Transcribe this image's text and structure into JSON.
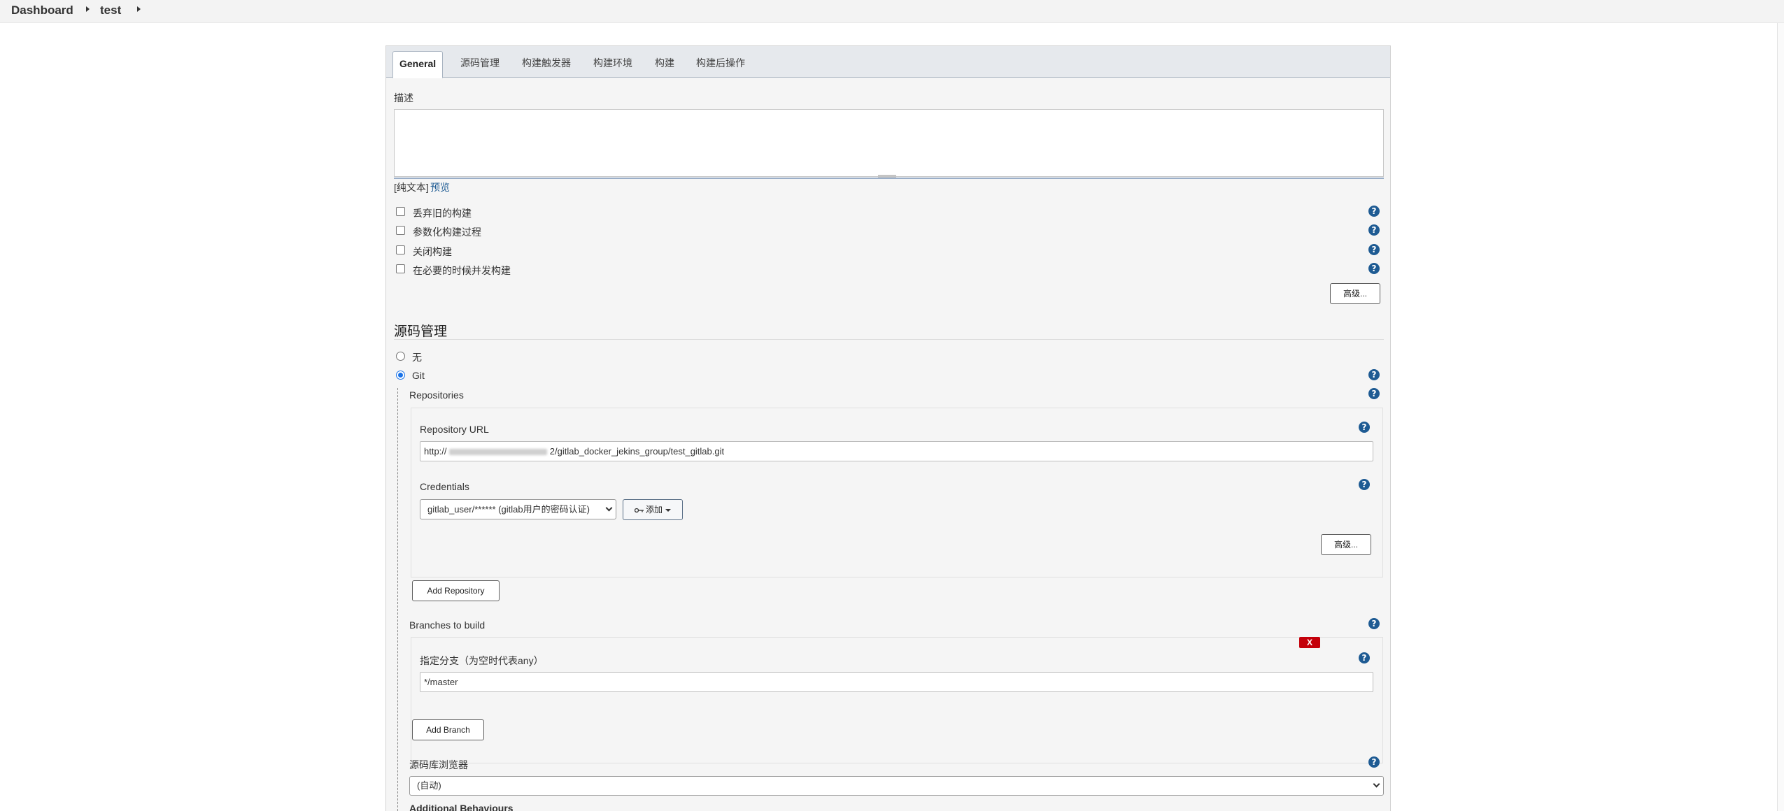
{
  "breadcrumb": {
    "items": [
      "Dashboard",
      "test"
    ]
  },
  "tabs": [
    "General",
    "源码管理",
    "构建触发器",
    "构建环境",
    "构建",
    "构建后操作"
  ],
  "general": {
    "description_label": "描述",
    "description_value": "",
    "format_prefix": "[纯文本]",
    "preview_link": "预览",
    "checkboxes": [
      "丢弃旧的构建",
      "参数化构建过程",
      "关闭构建",
      "在必要的时候并发构建"
    ],
    "advanced_button": "高级..."
  },
  "scm": {
    "title": "源码管理",
    "options": [
      "无",
      "Git"
    ],
    "repositories_label": "Repositories",
    "repo_url_label": "Repository URL",
    "repo_url_prefix": "http://",
    "repo_url_suffix": "2/gitlab_docker_jekins_group/test_gitlab.git",
    "credentials_label": "Credentials",
    "credentials_value": "gitlab_user/****** (gitlab用户的密码认证)",
    "add_button": "添加",
    "repo_advanced_button": "高级...",
    "add_repository_button": "Add Repository",
    "branches_label": "Branches to build",
    "delete_label": "X",
    "branch_spec_label": "指定分支（为空时代表any）",
    "branch_spec_value": "*/master",
    "add_branch_button": "Add Branch",
    "browser_label": "源码库浏览器",
    "browser_value": "(自动)",
    "additional_behaviours_label": "Additional Behaviours"
  },
  "colors": {
    "help_icon": "#1e5b93",
    "delete_button": "#c4000a",
    "link": "#1e5b93",
    "tab_bar": "#e6e9ed"
  }
}
